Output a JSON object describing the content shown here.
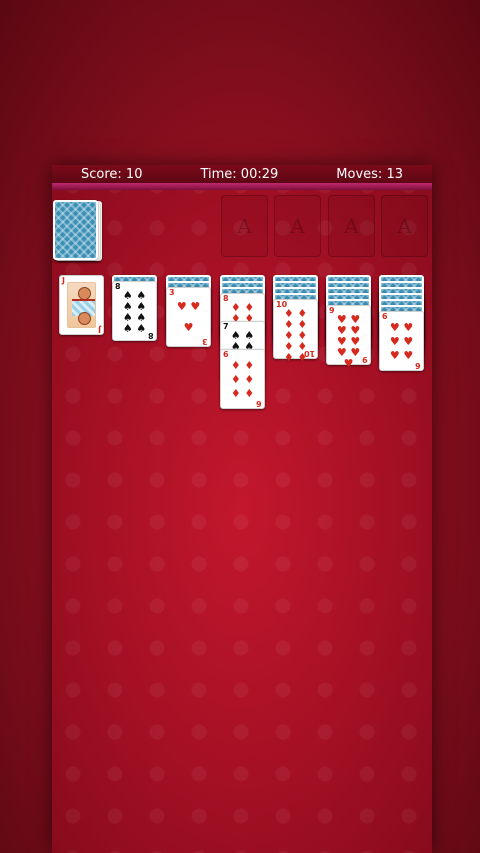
{
  "hud": {
    "score": "Score: 10",
    "time": "Time: 00:29",
    "moves": "Moves: 13"
  },
  "foundations": [
    "A",
    "A",
    "A",
    "A"
  ],
  "colors": {
    "accent": "#c0286f",
    "felt": "#a51024",
    "card_back": "#3a8fb5"
  },
  "tableau": [
    {
      "hidden": 0,
      "cards": [
        {
          "rank": "J",
          "suit": "♥",
          "color": "red",
          "face": true
        }
      ]
    },
    {
      "hidden": 1,
      "cards": [
        {
          "rank": "8",
          "suit": "♠",
          "color": "black"
        }
      ]
    },
    {
      "hidden": 2,
      "cards": [
        {
          "rank": "3",
          "suit": "♥",
          "color": "red"
        }
      ]
    },
    {
      "hidden": 3,
      "cards": [
        {
          "rank": "8",
          "suit": "♦",
          "color": "red"
        },
        {
          "rank": "7",
          "suit": "♠",
          "color": "black"
        },
        {
          "rank": "6",
          "suit": "♦",
          "color": "red"
        }
      ]
    },
    {
      "hidden": 4,
      "cards": [
        {
          "rank": "10",
          "suit": "♦",
          "color": "red"
        }
      ]
    },
    {
      "hidden": 5,
      "cards": [
        {
          "rank": "9",
          "suit": "♥",
          "color": "red"
        }
      ]
    },
    {
      "hidden": 6,
      "cards": [
        {
          "rank": "6",
          "suit": "♥",
          "color": "red"
        }
      ]
    }
  ]
}
